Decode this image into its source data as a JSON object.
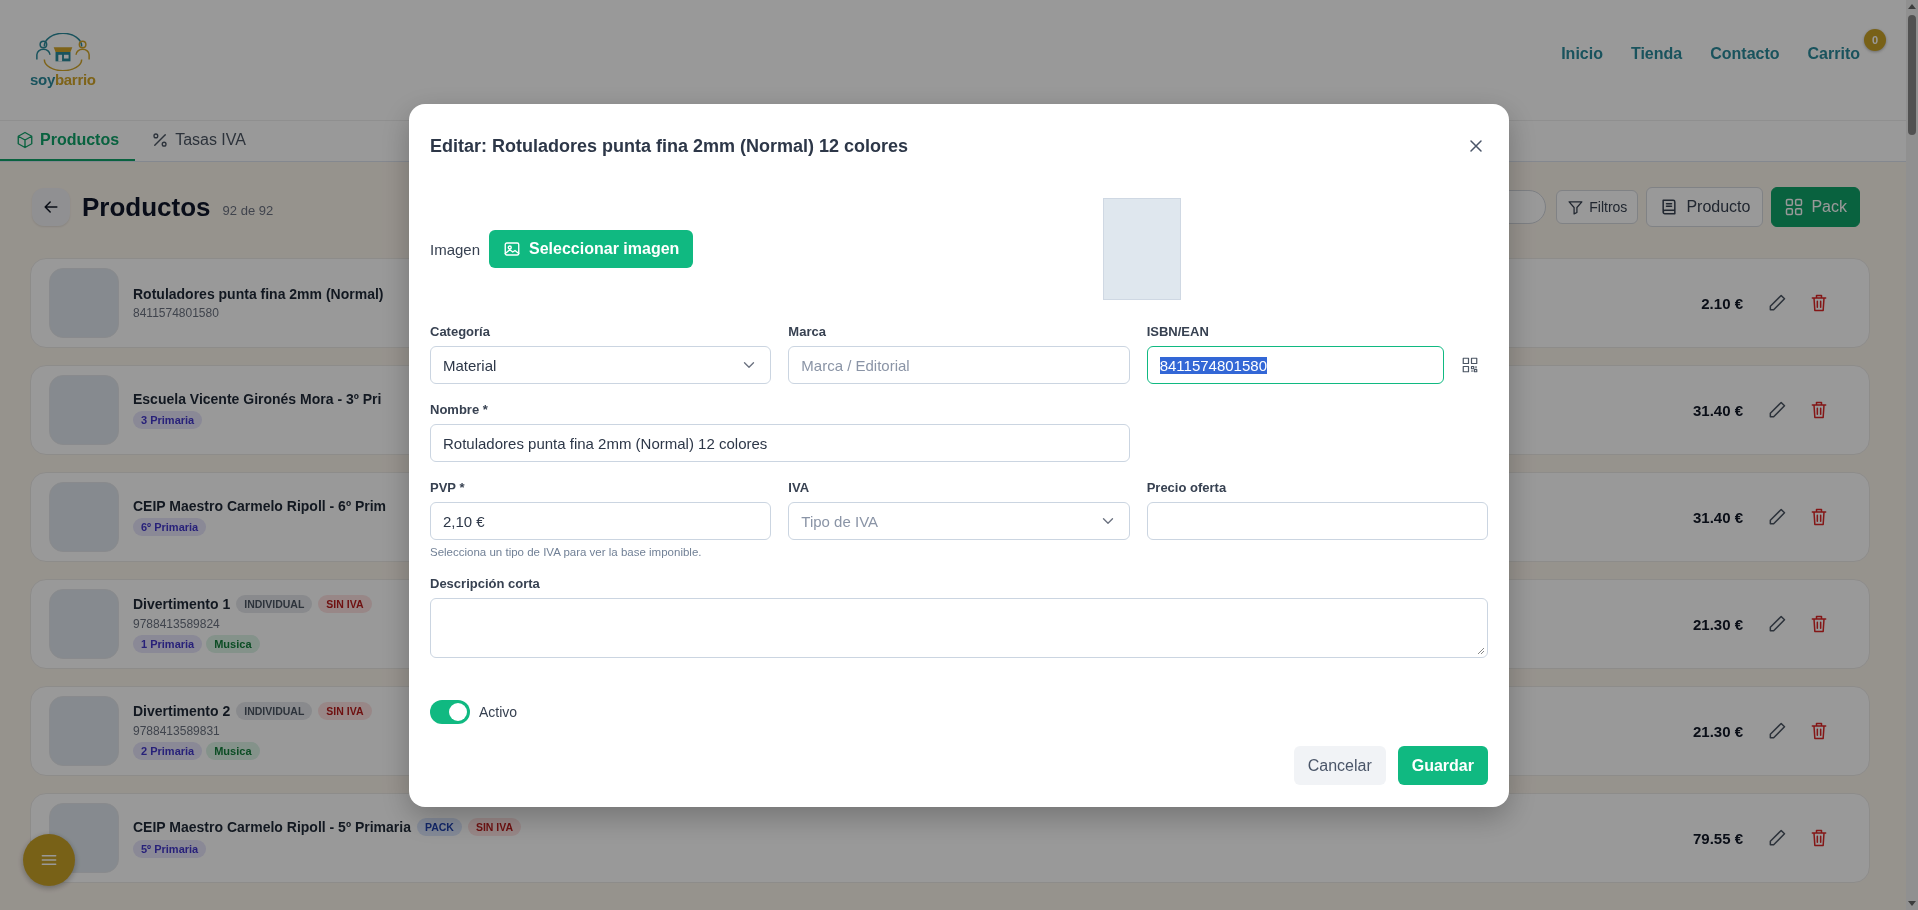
{
  "logo": {
    "parts": [
      "soy",
      "barrio"
    ]
  },
  "nav": {
    "links": [
      "Inicio",
      "Tienda",
      "Contacto",
      "Carrito"
    ],
    "cart_count": "0"
  },
  "tabs": [
    {
      "label": "Productos",
      "selected": true
    },
    {
      "label": "Tasas IVA",
      "selected": false
    }
  ],
  "toolbar": {
    "title": "Productos",
    "count": "92 de 92",
    "buttons": [
      {
        "label": "Filtros",
        "kind": "filter"
      },
      {
        "label": "Producto",
        "kind": "product"
      },
      {
        "label": "Pack",
        "kind": "pack"
      }
    ]
  },
  "products": [
    {
      "name": "Rotuladores punta fina 2mm (Normal)",
      "code": "8411574801580",
      "price": "2.10 €"
    },
    {
      "name": "Escuela Vicente Gironés Mora - 3º Pri",
      "tags": [
        {
          "label": "3 Primaria",
          "kind": "grade"
        }
      ],
      "price": "31.40 €"
    },
    {
      "name": "CEIP Maestro Carmelo Ripoll - 6º Prim",
      "tags": [
        {
          "label": "6º Primaria",
          "kind": "grade"
        }
      ],
      "price": "31.40 €"
    },
    {
      "name": "Divertimento 1",
      "code": "9788413589824",
      "inline_tags": [
        {
          "label": "INDIVIDUAL",
          "kind": "type"
        },
        {
          "label": "SIN IVA",
          "kind": "tax"
        }
      ],
      "tags": [
        {
          "label": "1 Primaria",
          "kind": "grade"
        },
        {
          "label": "Musica",
          "kind": "subject"
        }
      ],
      "price": "21.30 €"
    },
    {
      "name": "Divertimento 2",
      "code": "9788413589831",
      "inline_tags": [
        {
          "label": "INDIVIDUAL",
          "kind": "type"
        },
        {
          "label": "SIN IVA",
          "kind": "tax"
        }
      ],
      "tags": [
        {
          "label": "2 Primaria",
          "kind": "grade"
        },
        {
          "label": "Musica",
          "kind": "subject"
        }
      ],
      "price": "21.30 €"
    },
    {
      "name": "CEIP Maestro Carmelo Ripoll - 5º Primaria",
      "inline_tags": [
        {
          "label": "PACK",
          "kind": "pack"
        },
        {
          "label": "SIN IVA",
          "kind": "tax"
        }
      ],
      "tags": [
        {
          "label": "5º Primaria",
          "kind": "grade"
        }
      ],
      "price": "79.55 €"
    }
  ],
  "modal": {
    "title": "Editar: Rotuladores punta fina 2mm (Normal) 12 colores",
    "image_label": "Imagen",
    "image_button": "Seleccionar imagen",
    "fields": [
      {
        "label": "Categoría",
        "kind": "select",
        "value": "Material"
      },
      {
        "label": "Marca",
        "kind": "text",
        "placeholder": "Marca / Editorial"
      },
      {
        "label": "ISBN/EAN",
        "kind": "scan",
        "value": "8411574801580",
        "focused": true,
        "text_selected": true
      },
      {
        "label": "Nombre *",
        "kind": "wide",
        "value": "Rotuladores punta fina 2mm (Normal) 12 colores"
      },
      {
        "label": "PVP *",
        "kind": "text",
        "value": "2,10 €",
        "hint": "Selecciona un tipo de IVA para ver la base imponible."
      },
      {
        "label": "IVA",
        "kind": "select",
        "placeholder": "Tipo de IVA"
      },
      {
        "label": "Precio oferta",
        "kind": "text"
      },
      {
        "label": "Descripción corta",
        "kind": "textarea"
      }
    ],
    "toggle": {
      "label": "Activo",
      "on": true
    },
    "buttons": [
      {
        "label": "Cancelar",
        "kind": "secondary"
      },
      {
        "label": "Guardar",
        "kind": "primary"
      }
    ]
  }
}
